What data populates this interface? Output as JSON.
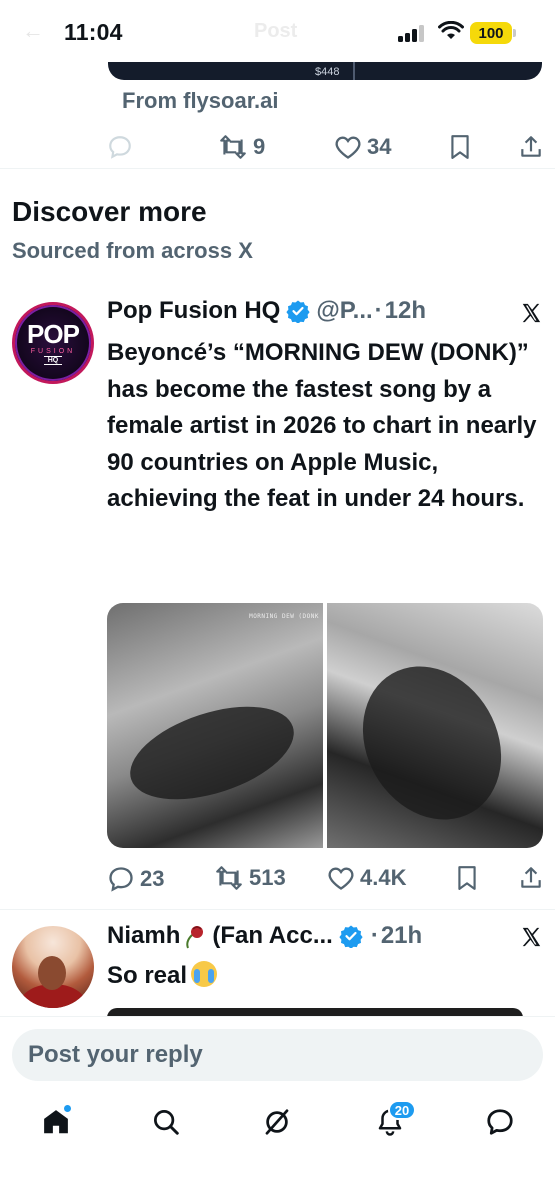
{
  "status_bar": {
    "time": "11:04",
    "battery": "100"
  },
  "nav": {
    "back_label": "←",
    "title": "Post"
  },
  "ad": {
    "price": "$448",
    "source": "From flysoar.ai",
    "actions": {
      "reposts": "9",
      "likes": "34"
    }
  },
  "discover": {
    "title": "Discover more",
    "subtitle": "Sourced from across X"
  },
  "tweets": [
    {
      "name": "Pop Fusion HQ",
      "handle": "@P...",
      "dot": "·",
      "time": "12h",
      "avatar_text": {
        "top": "POP",
        "middle": "FUSION",
        "bottom": "HQ"
      },
      "text": "Beyoncé’s “MORNING DEW (DONK)” has become the fastest song by a female artist in 2026 to chart in nearly 90 countries on Apple Music, achieving the feat in under 24 hours.",
      "media_caption": "MORNING DEW (DONK",
      "actions": {
        "replies": "23",
        "reposts": "513",
        "likes": "4.4K"
      }
    },
    {
      "name": "Niamh",
      "name_suffix": "(Fan Acc...",
      "dot": "·",
      "time": "21h",
      "text": "So real"
    }
  ],
  "reply": {
    "placeholder": "Post your reply"
  },
  "tab_bar": {
    "notifications_count": "20"
  },
  "icons": [
    "reply-icon",
    "repost-icon",
    "like-icon",
    "bookmark-icon",
    "share-icon",
    "verified-icon",
    "x-logo-icon",
    "home-icon",
    "search-icon",
    "grok-icon",
    "notifications-icon",
    "messages-icon"
  ],
  "colors": {
    "accent": "#1d9bf0",
    "secondary_text": "#536471",
    "battery": "#f5d90a"
  }
}
